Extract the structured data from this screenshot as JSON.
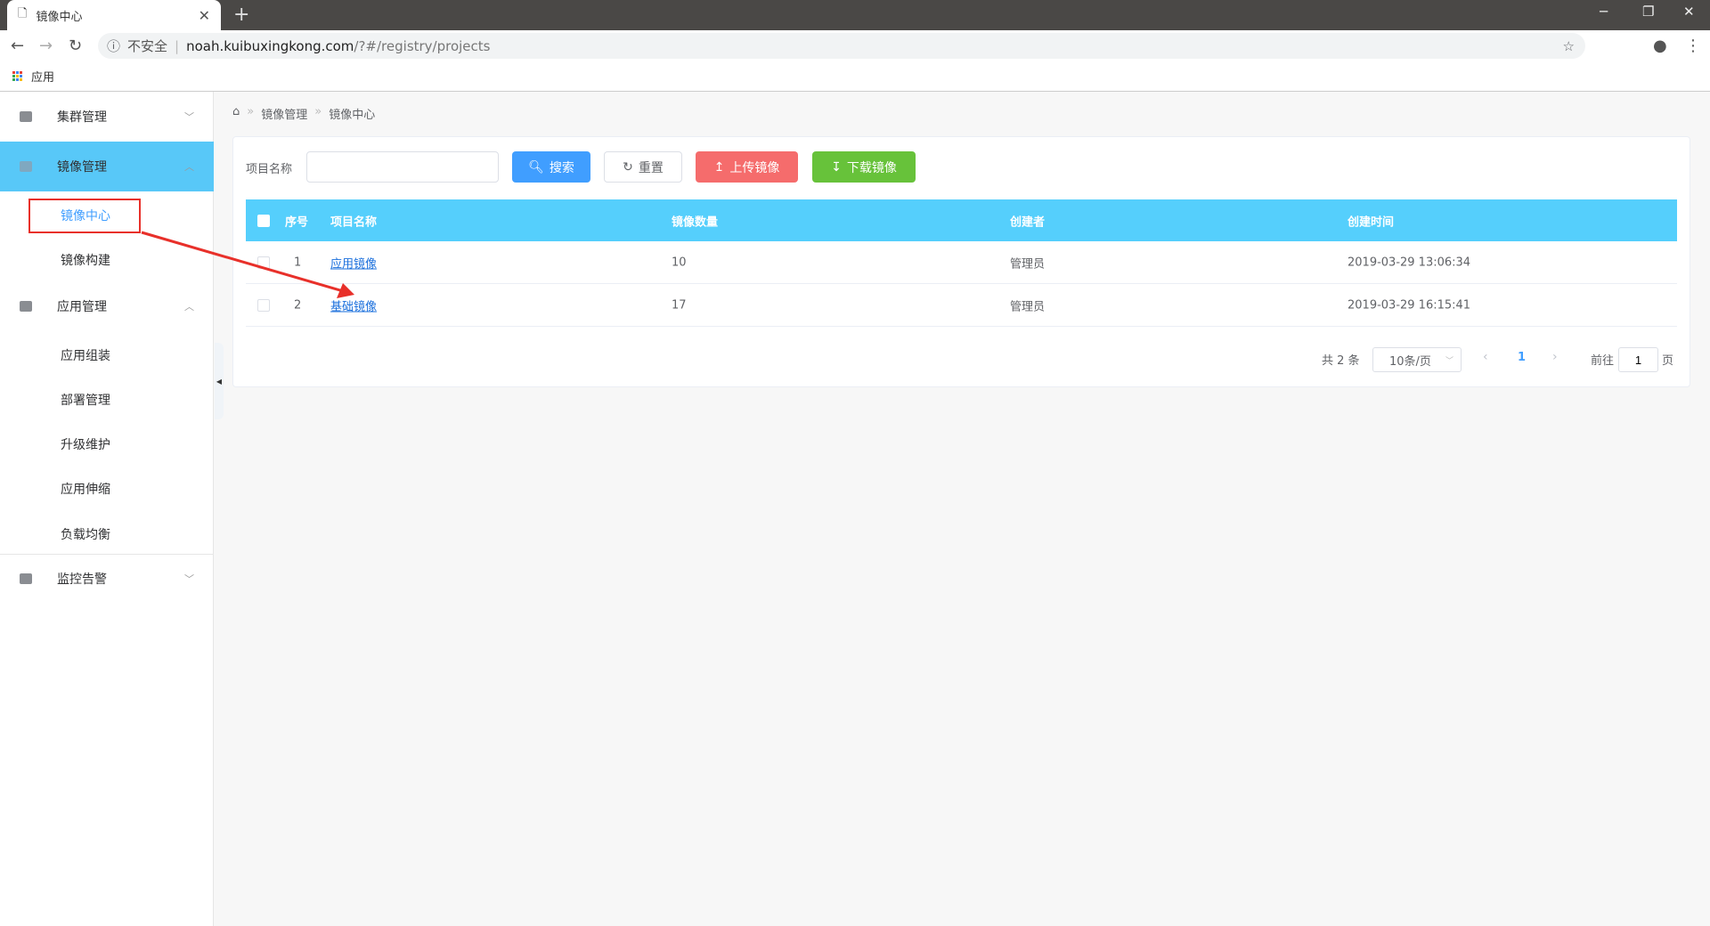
{
  "browser": {
    "tab_title": "镜像中心",
    "security": "不安全",
    "url_host": "noah.kuibuxingkong.com",
    "url_path": "/?#/registry/projects",
    "bookmark_apps": "应用"
  },
  "sidebar": {
    "items": [
      {
        "label": "集群管理"
      },
      {
        "label": "镜像管理",
        "children": [
          "镜像中心",
          "镜像构建"
        ]
      },
      {
        "label": "应用管理",
        "children": [
          "应用组装",
          "部署管理",
          "升级维护",
          "应用伸缩",
          "负载均衡"
        ]
      },
      {
        "label": "监控告警"
      }
    ]
  },
  "breadcrumb": [
    "镜像管理",
    "镜像中心"
  ],
  "search": {
    "label": "项目名称",
    "value": "",
    "search_btn": "搜索",
    "reset_btn": "重置",
    "upload_btn": "上传镜像",
    "download_btn": "下载镜像"
  },
  "table": {
    "headers": [
      "序号",
      "项目名称",
      "镜像数量",
      "创建者",
      "创建时间"
    ],
    "rows": [
      [
        "1",
        "应用镜像",
        "10",
        "管理员",
        "2019-03-29 13:06:34"
      ],
      [
        "2",
        "基础镜像",
        "17",
        "管理员",
        "2019-03-29 16:15:41"
      ]
    ]
  },
  "pagination": {
    "total": "共 2 条",
    "page_size": "10条/页",
    "current": "1",
    "goto_label": "前往",
    "goto_value": "1",
    "page_suffix": "页"
  },
  "colors": {
    "active_menu": "#58c8f8",
    "primary": "#409eff",
    "danger": "#f56c6c",
    "success": "#67c23a"
  }
}
